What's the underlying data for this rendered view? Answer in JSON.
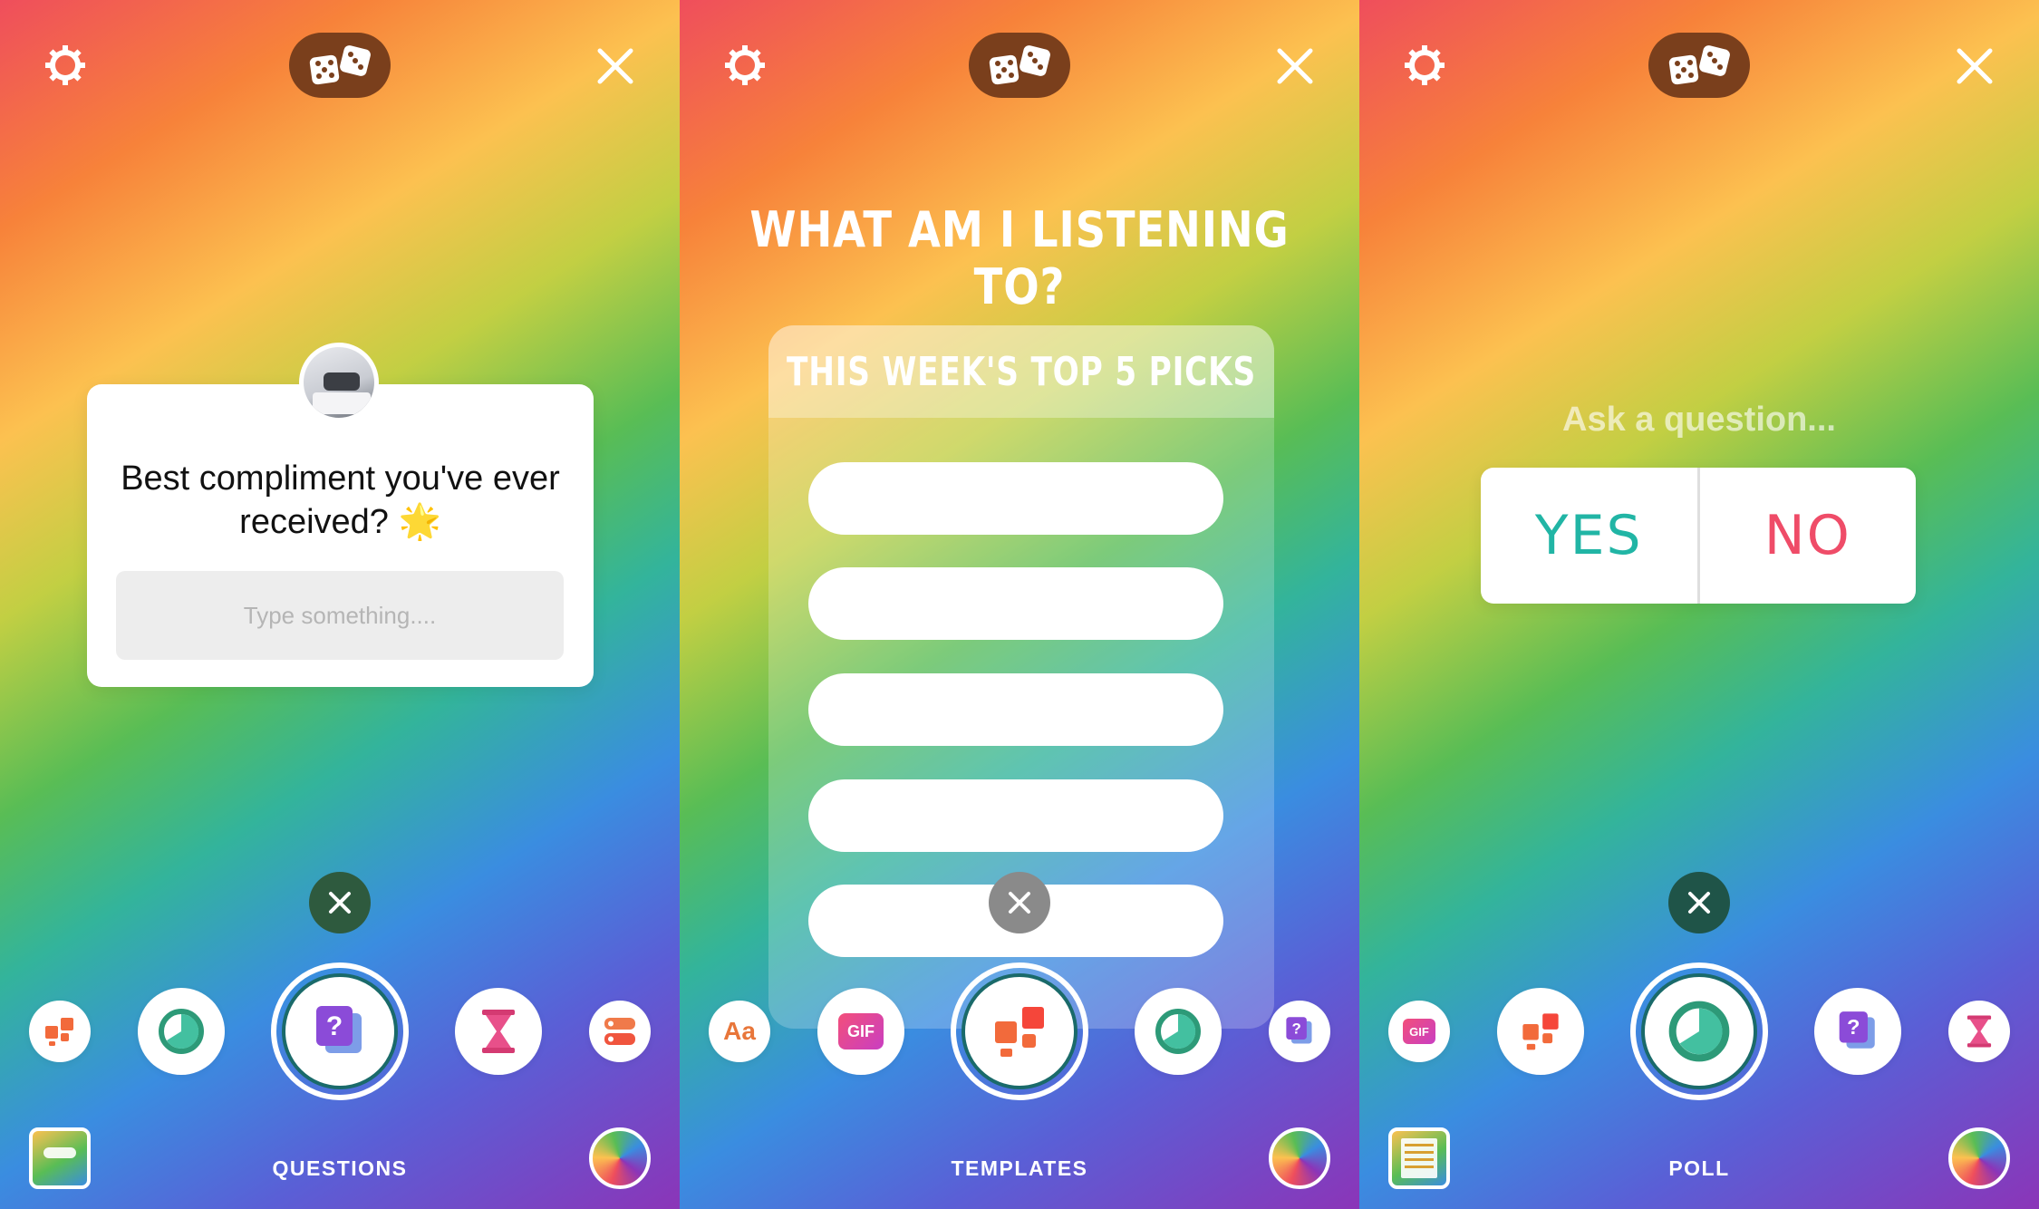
{
  "panels": [
    {
      "id": "questions",
      "top_bar": {
        "settings_icon": "gear-icon",
        "dice_icon": "dice-icon",
        "close_icon": "close-icon",
        "dice_bg": "#7a3f1c"
      },
      "card": {
        "question": "Best compliment you've ever received? 🌟",
        "input_placeholder": "Type something...."
      },
      "dismiss_color": "#2e5a3e",
      "tray": [
        "templates-icon",
        "poll-icon",
        "questions-icon",
        "countdown-icon",
        "quiz-icon"
      ],
      "mode_label": "QUESTIONS"
    },
    {
      "id": "templates",
      "top_bar": {
        "settings_icon": "gear-icon",
        "dice_icon": "dice-icon",
        "close_icon": "close-icon",
        "dice_bg": "#7a3f1c"
      },
      "heading": "WHAT AM I LISTENING TO?",
      "card": {
        "title": "THIS WEEK'S TOP 5 PICKS",
        "slots": [
          "",
          "",
          "",
          "",
          ""
        ]
      },
      "dismiss_color": "#8a8a8a",
      "tray": [
        "text-icon",
        "gif-icon",
        "templates-icon",
        "poll-icon",
        "questions-icon"
      ],
      "mode_label": "TEMPLATES"
    },
    {
      "id": "poll",
      "top_bar": {
        "settings_icon": "gear-icon",
        "dice_icon": "dice-icon",
        "close_icon": "close-icon",
        "dice_bg": "#7a3f1c"
      },
      "question_placeholder": "Ask a question...",
      "options": {
        "yes": "YES",
        "no": "NO",
        "yes_color": "#21b5a5",
        "no_color": "#ef4c68"
      },
      "dismiss_color": "#1f5448",
      "tray": [
        "gif-icon",
        "templates-icon",
        "poll-icon",
        "questions-icon",
        "countdown-icon"
      ],
      "mode_label": "POLL"
    }
  ],
  "tray_labels": {
    "text_icon": "Aa",
    "gif_icon": "GIF"
  }
}
